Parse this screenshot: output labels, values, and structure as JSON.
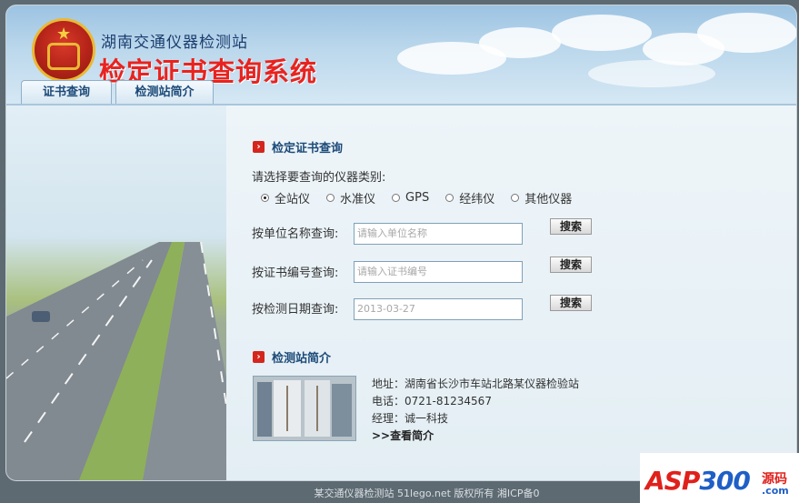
{
  "header": {
    "station_name": "湖南交通仪器检测站",
    "system_title": "检定证书查询系统",
    "tabs": [
      {
        "label": "证书查询"
      },
      {
        "label": "检测站简介"
      }
    ]
  },
  "search_section": {
    "title": "检定证书查询",
    "prompt": "请选择要查询的仪器类别:",
    "categories": [
      {
        "label": "全站仪",
        "selected": true
      },
      {
        "label": "水准仪",
        "selected": false
      },
      {
        "label": "GPS",
        "selected": false
      },
      {
        "label": "经纬仪",
        "selected": false
      },
      {
        "label": "其他仪器",
        "selected": false
      }
    ],
    "rows": [
      {
        "label": "按单位名称查询:",
        "placeholder": "请输入单位名称",
        "value": "",
        "button": "搜索"
      },
      {
        "label": "按证书编号查询:",
        "placeholder": "请输入证书编号",
        "value": "",
        "button": "搜索"
      },
      {
        "label": "按检测日期查询:",
        "placeholder": "",
        "value": "2013-03-27",
        "button": "搜索"
      }
    ]
  },
  "intro_section": {
    "title": "检测站简介",
    "address": "地址：湖南省长沙市车站北路某仪器检验站",
    "phone": "电话：0721-81234567",
    "manager": "经理：诚一科技",
    "more_link": ">>查看简介"
  },
  "footer": {
    "text": "某交通仪器检测站 51lego.net   版权所有   湘ICP备0"
  },
  "watermark": {
    "brand_a": "ASP",
    "brand_b": "300",
    "suffix": "源码",
    "domain": ".com"
  },
  "colors": {
    "title_red": "#e8231f",
    "heading_blue": "#1c4a78",
    "accent_red": "#d4261c"
  },
  "icons": [
    "emblem-icon",
    "section-arrow-icon",
    "radio-icon"
  ]
}
